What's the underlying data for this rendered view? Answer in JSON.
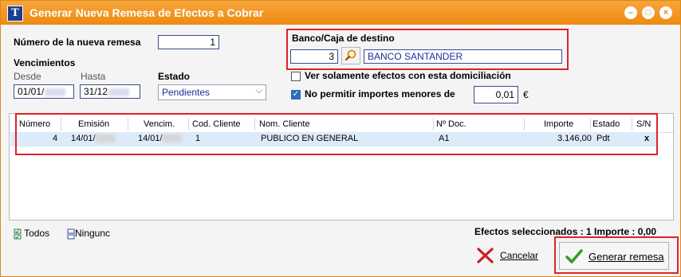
{
  "window": {
    "title": "Generar Nueva Remesa de Efectos a Cobrar"
  },
  "remesa": {
    "label": "Número de la nueva remesa",
    "value": "1"
  },
  "vencimientos": {
    "label": "Vencimientos",
    "desde_label": "Desde",
    "desde_value": "01/01/",
    "hasta_label": "Hasta",
    "hasta_value": "31/12"
  },
  "estado": {
    "label": "Estado",
    "value": "Pendientes"
  },
  "banco": {
    "label": "Banco/Caja de destino",
    "code": "3",
    "name": "BANCO SANTANDER"
  },
  "options": {
    "ver_solamente": {
      "label": "Ver solamente efectos con esta domiciliación",
      "checked": false
    },
    "no_permitir": {
      "label": "No permitir importes menores de",
      "checked": true,
      "value": "0,01",
      "currency": "€"
    }
  },
  "table": {
    "columns": [
      "Número",
      "Emisión",
      "Vencim.",
      "Cod. Cliente",
      "Nom. Cliente",
      "Nº Doc.",
      "Importe",
      "Estado",
      "S/N"
    ],
    "rows": [
      {
        "numero": "4",
        "emision": "14/01/",
        "vencim": "14/01/",
        "cod_cliente": "1",
        "nom_cliente": "PUBLICO EN GENERAL",
        "doc": "A1",
        "importe": "3.146,00",
        "estado": "Pdt",
        "sn": "x"
      }
    ]
  },
  "footer": {
    "todos": "Todos",
    "ninguno": "Ningunc",
    "summary": "Efectos seleccionados : 1 Importe : 0,00",
    "cancel_label": "Cancelar",
    "generate_label": "Generar remesa"
  },
  "colors": {
    "title_bar": "#ee8a12",
    "highlight": "#e0212b",
    "field_border": "#3a4c93",
    "selected_row": "#ddeaf9"
  }
}
